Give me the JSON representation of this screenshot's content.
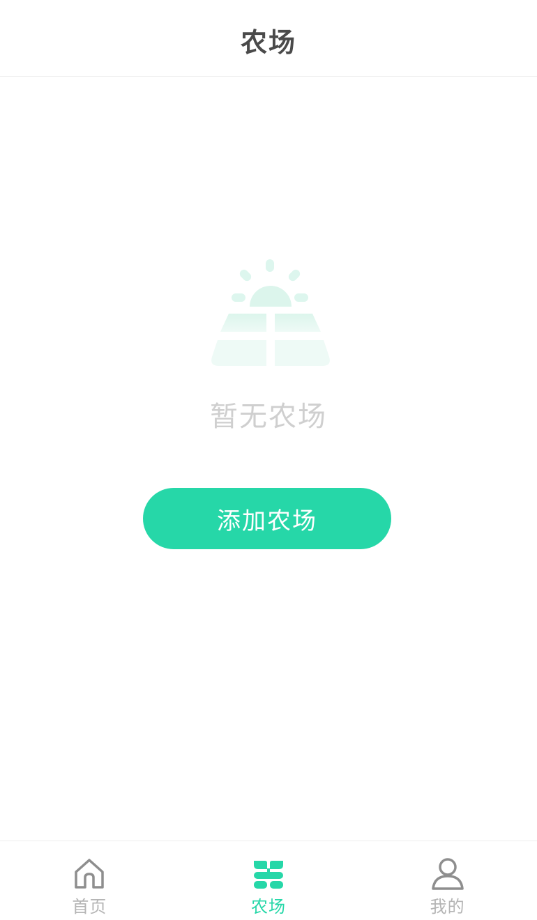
{
  "header": {
    "title": "农场"
  },
  "empty_state": {
    "message": "暂无农场",
    "illustration_icon": "farm-sunrise-icon"
  },
  "add_button": {
    "label": "添加农场"
  },
  "tabbar": {
    "active_color": "#26d7a8",
    "inactive_color": "#b5b5b5",
    "tabs": [
      {
        "label": "首页",
        "icon": "home-icon",
        "active": false
      },
      {
        "label": "农场",
        "icon": "sprout-icon",
        "active": true
      },
      {
        "label": "我的",
        "icon": "user-icon",
        "active": false
      }
    ]
  },
  "colors": {
    "accent": "#26d7a8",
    "illustration": "#e6f8f1",
    "title_text": "#4a4a4a",
    "empty_text": "#cfcfcf"
  }
}
